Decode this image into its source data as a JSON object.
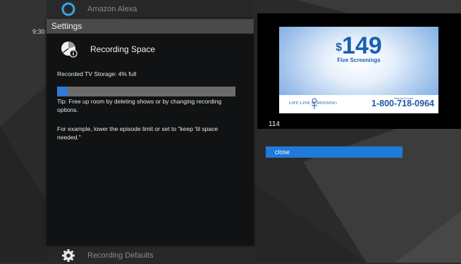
{
  "clock": "9:30",
  "menu": {
    "top_label": "Amazon Alexa",
    "top_icon": "alexa-ring-icon",
    "bottom_label": "Recording Defaults",
    "bottom_icon": "gear-icon"
  },
  "panel": {
    "header": "Settings",
    "section_icon": "pie-chart-info-icon",
    "section_title": "Recording Space",
    "storage_text": "Recorded TV Storage: 4% full",
    "storage_percent": 4,
    "tip": "Tip: Free up room by deleting shows or by changing recording options.",
    "example": "For example, lower the episode limit or set to \"keep 'til space needed.\""
  },
  "preview": {
    "ad_dollar": "$",
    "ad_price": "149",
    "ad_subtitle": "Five Screenings",
    "ad_brand": "LIFE LINE SCREENING",
    "ad_website": "LifeLineTV.com",
    "ad_phone": "1-800-718-0964",
    "channel": "114"
  },
  "actions": {
    "close_label": "close"
  },
  "colors": {
    "accent": "#1f7ad9",
    "progress_fill": "#2e7ad8",
    "progress_track": "#6b6b6b",
    "panel_bg": "#111213",
    "header_bg": "#4a4a4a"
  }
}
